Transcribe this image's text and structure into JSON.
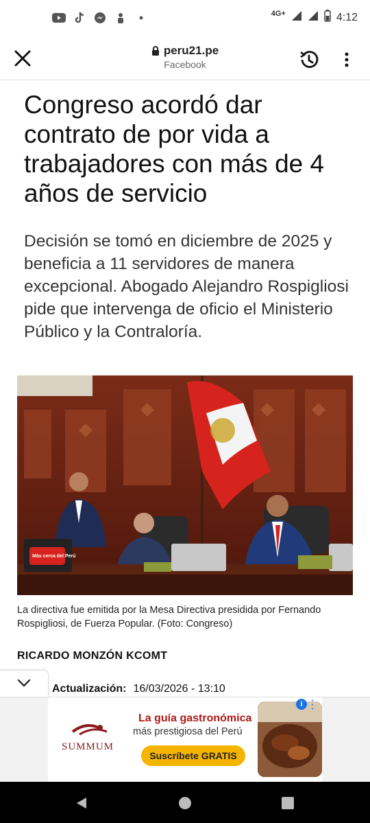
{
  "status_bar": {
    "network": "4G+",
    "time": "4:12",
    "notification_icons": [
      "youtube-icon",
      "tiktok-icon",
      "messenger-icon",
      "hand-icon",
      "dot-icon"
    ]
  },
  "toolbar": {
    "domain": "peru21.pe",
    "source": "Facebook"
  },
  "article": {
    "headline": "Congreso acordó dar contrato de por vida a trabajadores con más de 4 años de servicio",
    "deck": "Decisión se tomó en diciembre de 2025 y beneficia a 11 servidores de manera excepcional. Abogado Alejandro Rospigliosi pide que intervenga de oficio el Ministerio Público y la Contraloría.",
    "photo_sign": "Más cerca del Perú",
    "caption": "La directiva fue emitida por la Mesa Directiva presidida por Fernando Rospigliosi, de Fuerza Popular. (Foto: Congreso)",
    "author": "RICARDO MONZÓN KCOMT",
    "updated_label": "Actualización:",
    "updated_value": "16/03/2026 - 13:10"
  },
  "ad": {
    "brand": "SUMMUM",
    "line1": "La guía gastronómica",
    "line2": "más prestigiosa del Perú",
    "cta": "Suscríbete GRATIS",
    "info": "i"
  },
  "colors": {
    "accent": "#1a73e8",
    "flag_red": "#d6231e",
    "ad_red": "#b01818",
    "cta_yellow": "#f4b400"
  }
}
